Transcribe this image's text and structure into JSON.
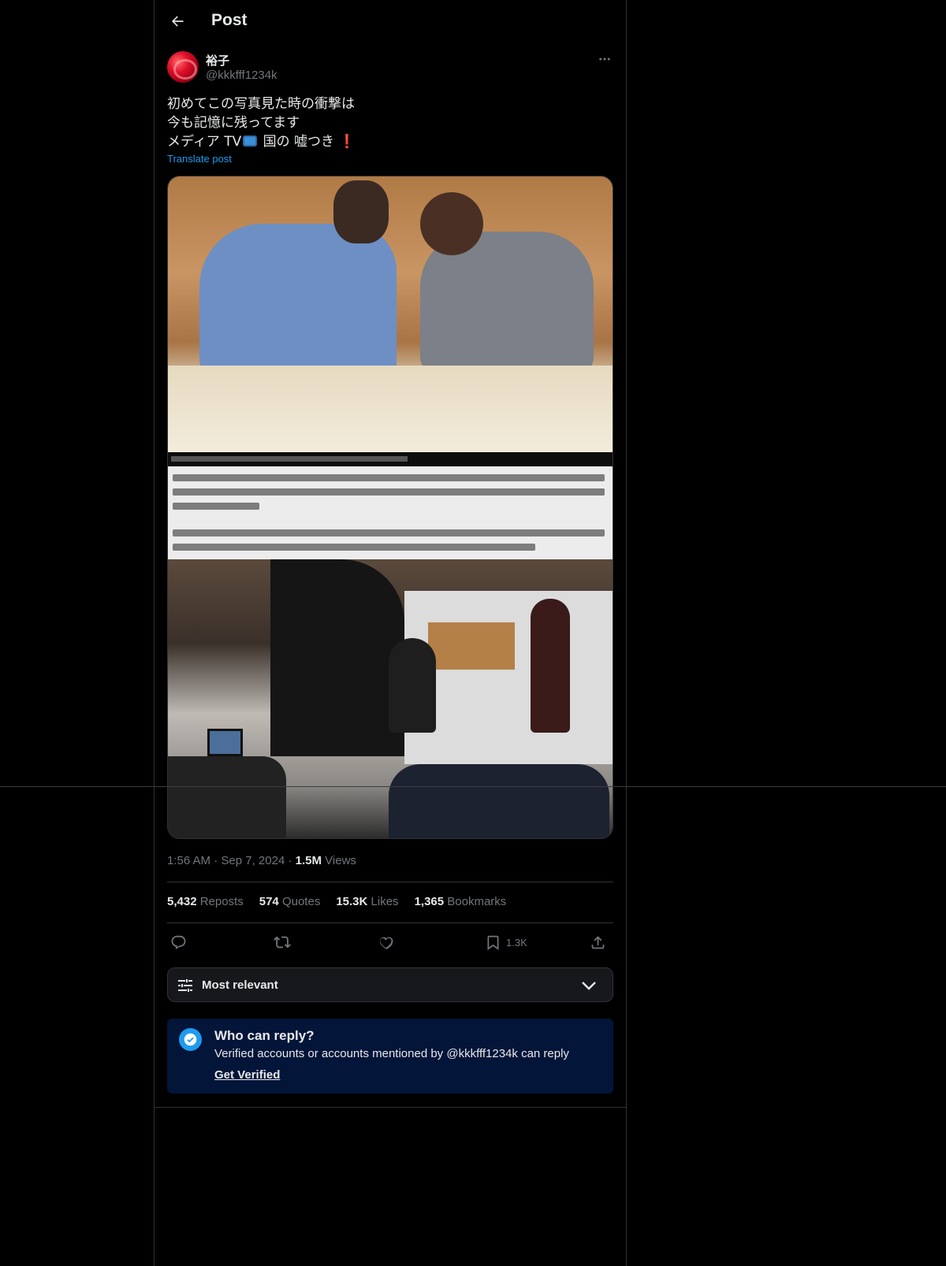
{
  "header": {
    "title": "Post",
    "back_icon": "arrow-left-icon"
  },
  "author": {
    "name": "裕子",
    "handle": "@kkkfff1234k"
  },
  "post": {
    "line1": "初めてこの写真見た時の衝撃は",
    "line2": "今も記憶に残ってます",
    "line3_prefix": "メディア TV",
    "line3_middle": " 国の 嘘つき",
    "line3_excl": "❗",
    "translate_label": "Translate post"
  },
  "meta": {
    "time": "1:56 AM",
    "date": "Sep 7, 2024",
    "views_count": "1.5M",
    "views_label": "Views"
  },
  "stats": [
    {
      "count": "5,432",
      "label": "Reposts"
    },
    {
      "count": "574",
      "label": "Quotes"
    },
    {
      "count": "15.3K",
      "label": "Likes"
    },
    {
      "count": "1,365",
      "label": "Bookmarks"
    }
  ],
  "actions": {
    "bookmark_count": "1.3K"
  },
  "sort": {
    "label": "Most relevant"
  },
  "reply": {
    "title": "Who can reply?",
    "description": "Verified accounts or accounts mentioned by @kkkfff1234k can reply",
    "link": "Get Verified"
  },
  "colors": {
    "accent": "#1d9bf0",
    "background": "#000000",
    "muted": "#71767b",
    "reply_box": "#031539"
  }
}
